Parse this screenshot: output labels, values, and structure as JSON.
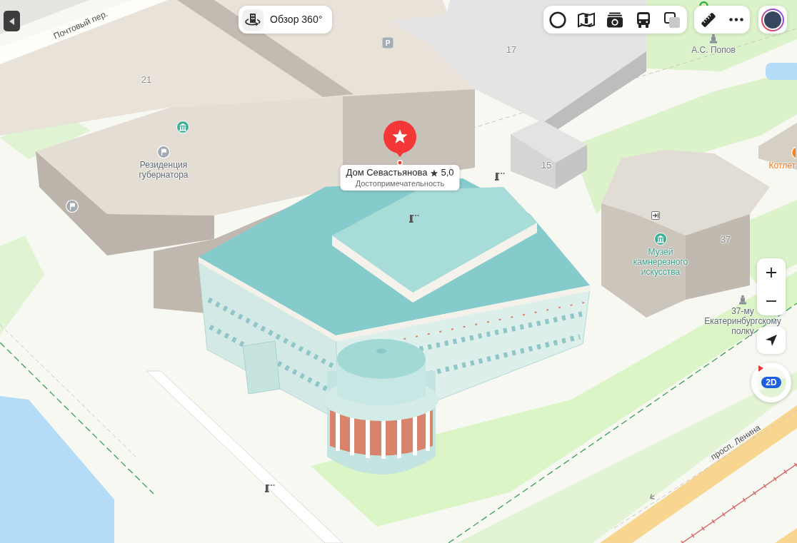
{
  "map": {
    "labels": [
      {
        "kind": "street",
        "text": "Почтовый пер."
      },
      {
        "kind": "number",
        "text": "21"
      },
      {
        "kind": "parking",
        "text": "P"
      },
      {
        "kind": "number",
        "text": "17"
      },
      {
        "kind": "poi",
        "text": "А.С. Попов",
        "color": "#6b7077"
      },
      {
        "kind": "poi",
        "text": "Резиденция губернатора",
        "color": "#5f6873"
      },
      {
        "kind": "number",
        "text": "15"
      },
      {
        "kind": "poi",
        "text": "Котлет",
        "color": "#f07a1e"
      },
      {
        "kind": "poi",
        "text": "Музей камнерезного искусства",
        "color": "#3a9c88"
      },
      {
        "kind": "number",
        "text": "37"
      },
      {
        "kind": "poi",
        "text": "37-му Екатеринбургскому полку",
        "color": "#5f6873"
      },
      {
        "kind": "street",
        "text": "просп. Ленина"
      }
    ]
  },
  "place": {
    "title": "Дом Севастьянова",
    "rating": "5,0",
    "category": "Достопримечательность"
  },
  "panorama_button": {
    "label": "Обзор 360°"
  },
  "compass": {
    "view_mode": "2D"
  }
}
